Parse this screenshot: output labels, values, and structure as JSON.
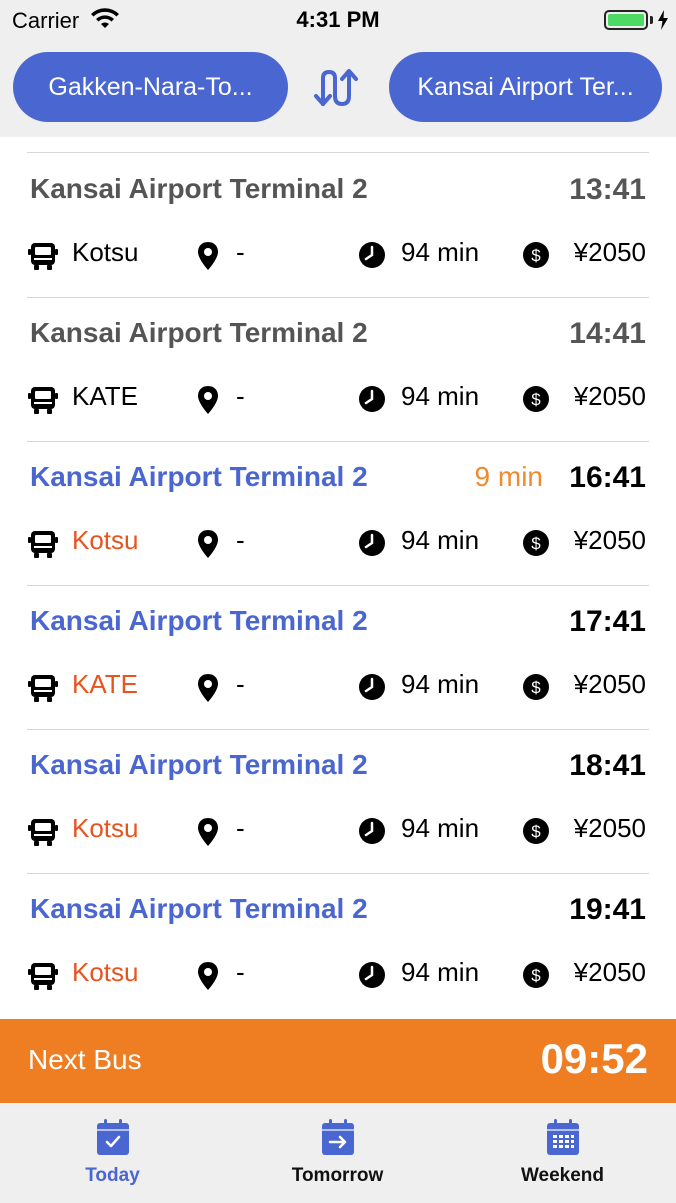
{
  "status_bar": {
    "carrier": "Carrier",
    "time": "4:31 PM",
    "battery_level": 1.0
  },
  "route": {
    "from": "Gakken-Nara-To...",
    "to": "Kansai Airport Ter...",
    "swap_icon": "swap-icon"
  },
  "departures": [
    {
      "destination": "Kansai Airport Terminal 2",
      "countdown": "",
      "time": "13:41",
      "operator": "Kotsu",
      "stop": "-",
      "duration": "94 min",
      "fare": "¥2050",
      "state": "past"
    },
    {
      "destination": "Kansai Airport Terminal 2",
      "countdown": "",
      "time": "14:41",
      "operator": "KATE",
      "stop": "-",
      "duration": "94 min",
      "fare": "¥2050",
      "state": "past"
    },
    {
      "destination": "Kansai Airport Terminal 2",
      "countdown": "9 min",
      "time": "16:41",
      "operator": "Kotsu",
      "stop": "-",
      "duration": "94 min",
      "fare": "¥2050",
      "state": "upcoming"
    },
    {
      "destination": "Kansai Airport Terminal 2",
      "countdown": "",
      "time": "17:41",
      "operator": "KATE",
      "stop": "-",
      "duration": "94 min",
      "fare": "¥2050",
      "state": "upcoming"
    },
    {
      "destination": "Kansai Airport Terminal 2",
      "countdown": "",
      "time": "18:41",
      "operator": "Kotsu",
      "stop": "-",
      "duration": "94 min",
      "fare": "¥2050",
      "state": "upcoming"
    },
    {
      "destination": "Kansai Airport Terminal 2",
      "countdown": "",
      "time": "19:41",
      "operator": "Kotsu",
      "stop": "-",
      "duration": "94 min",
      "fare": "¥2050",
      "state": "upcoming"
    }
  ],
  "next_bus": {
    "label": "Next Bus",
    "countdown": "09:52"
  },
  "tabs": [
    {
      "label": "Today",
      "icon": "calendar-check-icon",
      "active": true
    },
    {
      "label": "Tomorrow",
      "icon": "calendar-arrow-icon",
      "active": false
    },
    {
      "label": "Weekend",
      "icon": "calendar-grid-icon",
      "active": false
    }
  ],
  "colors": {
    "accent_blue": "#4a66d0",
    "past_text": "#555555",
    "operator_orange": "#e8541e",
    "countdown_orange": "#f08a2e",
    "next_bus_bar": "#ef7d22",
    "tab_active": "#4a66d0",
    "tab_inactive": "#111111"
  }
}
